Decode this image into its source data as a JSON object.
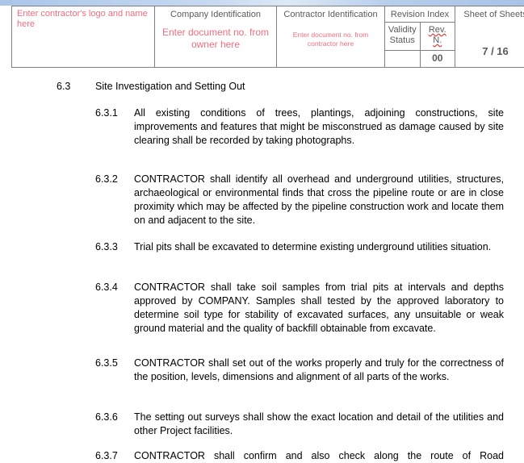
{
  "header": {
    "contractor_logo_placeholder": "Enter contractor's logo and name here",
    "company_identification_label": "Company Identification",
    "company_document_placeholder": "Enter document no. from owner here",
    "contractor_identification_label": "Contractor Identification",
    "contractor_document_placeholder": "Enter document no. from contractor here",
    "revision_index_label": "Revision Index",
    "validity_status_label": "Validity Status",
    "rev_no_label_1": "Rev.",
    "rev_no_label_2": "N.",
    "validity_status_value": "",
    "rev_no_value": "00",
    "sheet_label": "Sheet  of Sheets",
    "sheet_value": "7 / 16"
  },
  "section": {
    "number": "6.3",
    "title": "Site Investigation and Setting Out"
  },
  "items": [
    {
      "number": "6.3.1",
      "text": "All existing conditions of trees, plantings, adjoining constructions, site improvements and features that might be misconstrued as damage caused by site clearing shall be recorded by taking photographs."
    },
    {
      "number": "6.3.2",
      "text": "CONTRACTOR shall identify all overhead and underground utilities, structures, archaeological or environmental finds that cross the pipeline route or are in close proximity which may be affected by the pipeline construction work and locate them on and adjacent to the site."
    },
    {
      "number": "6.3.3",
      "text": "Trial pits shall be excavated to determine existing underground utilities situation."
    },
    {
      "number": "6.3.4",
      "text": "CONTRACTOR shall take soil samples from trial pits at intervals and depths approved by COMPANY. Samples shall tested by the approved laboratory to determine soil type for stability of excavated surfaces, any unsuitable or weak ground material and the quality of backfill obtainable from excavate."
    },
    {
      "number": "6.3.5",
      "text": "CONTRACTOR shall set out of the works properly and truly for the correctness of the position, levels, dimensions and alignment of all parts of the works."
    },
    {
      "number": "6.3.6",
      "text": "The setting out surveys shall show the exact location and detail of the utilities and other Project facilities."
    },
    {
      "number": "6.3.7",
      "text": "CONTRACTOR shall confirm and also check along the route of Road"
    }
  ]
}
